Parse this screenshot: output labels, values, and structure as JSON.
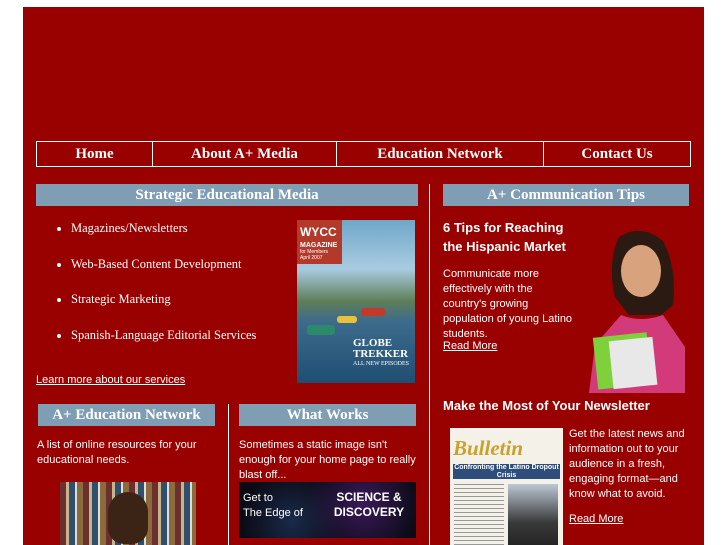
{
  "nav": {
    "items": [
      "Home",
      "About A+ Media",
      "Education Network",
      "Contact Us"
    ]
  },
  "strategic": {
    "header": "Strategic Educational Media",
    "services": [
      "Magazines/Newsletters",
      "Web-Based Content Development",
      "Strategic Marketing",
      "Spanish-Language Editorial Services"
    ],
    "learn_more": "Learn more about our services",
    "magazine": {
      "brand": "WYCC",
      "title": "MAGAZINE",
      "subtitle": "for Members",
      "month": "April 2007",
      "feature": "GLOBE TREKKER",
      "feature_sub": "ALL NEW EPISODES"
    }
  },
  "tips": {
    "header": "A+ Communication Tips",
    "tip1": {
      "title": "6 Tips for Reaching the Hispanic Market",
      "body": "Communicate more effectively with the country's growing population of young Latino students.",
      "read_more": "Read More"
    },
    "tip2": {
      "title": "Make the Most of Your Newsletter",
      "body": "Get the latest news and information out to your audience in a fresh, engaging format—and know what to avoid.",
      "read_more": "Read More",
      "bulletin_title": "Bulletin",
      "bulletin_headline": "Confronting the Latino Dropout Crisis"
    }
  },
  "edu_network": {
    "header": "A+ Education Network",
    "body": "A list of online resources for your educational needs."
  },
  "what_works": {
    "header": "What Works",
    "body": "Sometimes a static image isn't enough for your home page to really blast off...",
    "banner_left_1": "Get to",
    "banner_left_2": "The Edge of",
    "banner_right_1": "SCIENCE &",
    "banner_right_2": "DISCOVERY"
  },
  "colors": {
    "background": "#990000",
    "header_blue": "#7f9db3"
  }
}
